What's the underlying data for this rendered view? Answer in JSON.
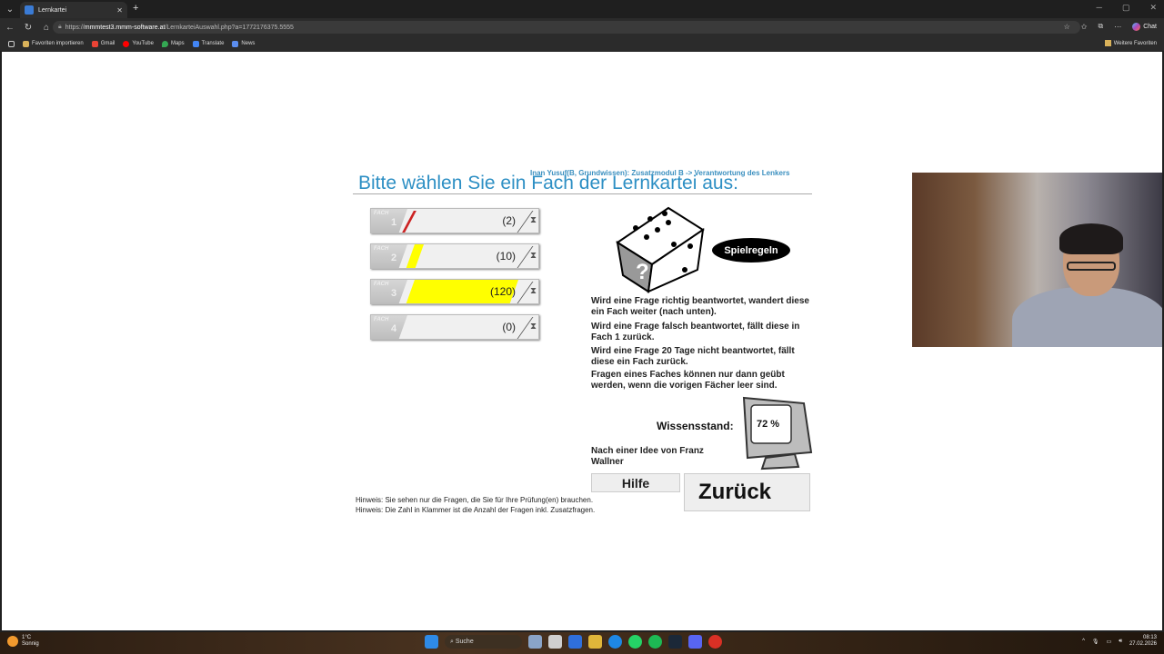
{
  "browser": {
    "tab_title": "Lernkartei",
    "url_prefix": "https://",
    "url_host": "mmmtest3.mmm-software.at",
    "url_path": "/LernkarteiAuswahl.php?a=1772176375.5555",
    "chat_label": "Chat",
    "bookmarks": [
      "Favoriten importieren",
      "Gmail",
      "YouTube",
      "Maps",
      "Translate",
      "News"
    ],
    "bookmarks_right": "Weitere Favoriten"
  },
  "page": {
    "breadcrumb": "Inan Yusuf(B, Grundwissen): Zusatzmodul B -> Verantwortung des Lenkers",
    "heading": "Bitte wählen Sie ein Fach der Lernkartei aus:",
    "fach_label": "FACH",
    "faecher": [
      {
        "number": "1",
        "count": "(2)",
        "fill_fraction": 0.0
      },
      {
        "number": "2",
        "count": "(10)",
        "fill_fraction": 0.08
      },
      {
        "number": "3",
        "count": "(120)",
        "fill_fraction": 0.85
      },
      {
        "number": "4",
        "count": "(0)",
        "fill_fraction": 0.0
      }
    ],
    "rules_button": "Spielregeln",
    "rules": [
      "Wird eine Frage richtig beantwortet, wandert diese ein Fach weiter (nach unten).",
      "Wird eine Frage falsch beantwortet, fällt diese in Fach 1 zurück.",
      "Wird eine Frage 20 Tage nicht beantwortet, fällt diese ein Fach zurück.",
      "Fragen eines Faches können nur dann geübt werden, wenn die vorigen Fächer leer sind."
    ],
    "wissensstand_label": "Wissensstand:",
    "wissensstand_value": "72 %",
    "idea": "Nach einer Idee von Franz Wallner",
    "help_button": "Hilfe",
    "back_button": "Zurück",
    "hints": [
      "Hinweis: Sie sehen nur die Fragen, die Sie für Ihre Prüfung(en) brauchen.",
      "Hinweis: Die Zahl in Klammer ist die Anzahl der Fragen inkl. Zusatzfragen."
    ]
  },
  "taskbar": {
    "weather_temp": "1°C",
    "weather_text": "Sonnig",
    "search": "Suche",
    "time": "08:13",
    "date": "27.02.2026"
  }
}
